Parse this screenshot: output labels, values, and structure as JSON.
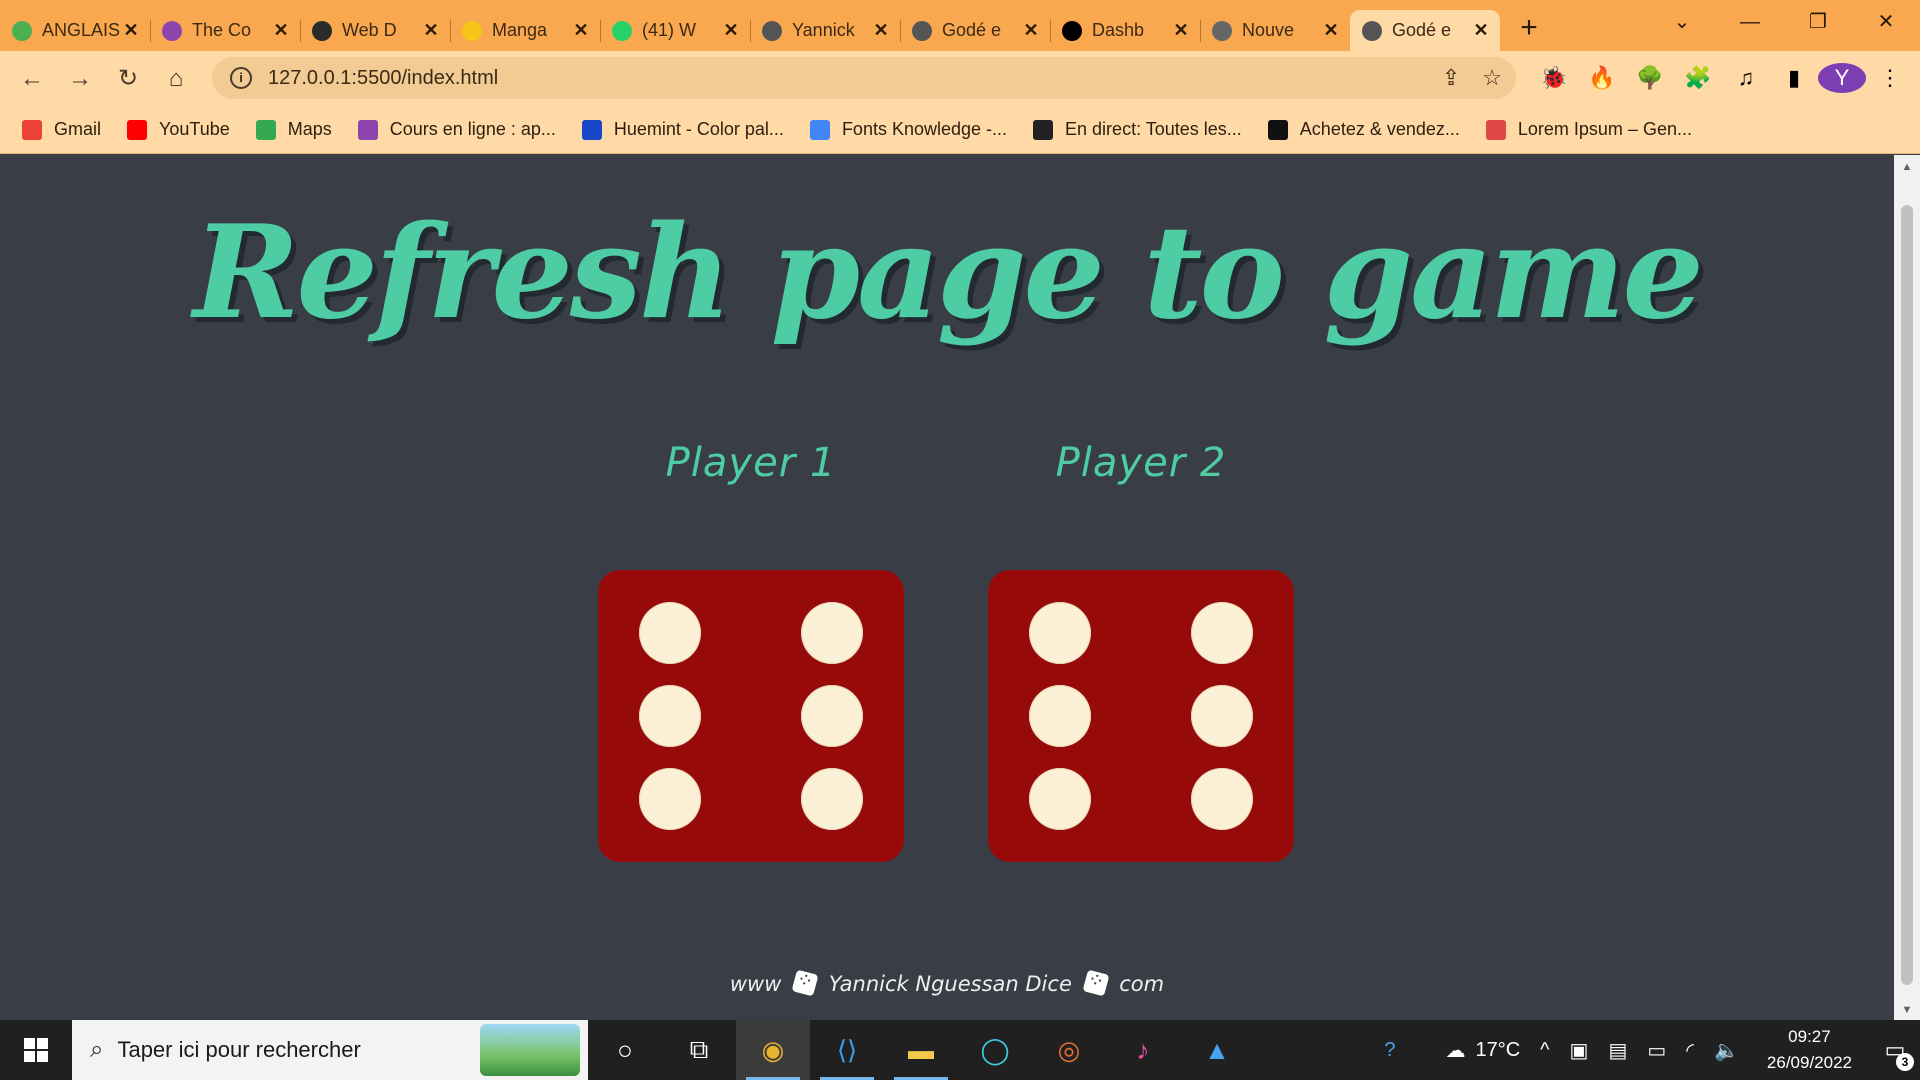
{
  "browser": {
    "tabs": [
      {
        "title": "ANGLAIS",
        "icon": "leaf-icon",
        "color": "#4caf50",
        "active": false
      },
      {
        "title": "The Co",
        "icon": "udemy-icon",
        "color": "#8e44ad",
        "active": false
      },
      {
        "title": "Web D",
        "icon": "hand-icon",
        "color": "#2b2b2b",
        "active": false
      },
      {
        "title": "Manga",
        "icon": "m-logo-icon",
        "color": "#f5c518",
        "active": false
      },
      {
        "title": "(41) W",
        "icon": "whatsapp-icon",
        "color": "#25d366",
        "active": false
      },
      {
        "title": "Yannick",
        "icon": "globe-icon",
        "color": "#555555",
        "active": false
      },
      {
        "title": "Godé e",
        "icon": "globe-icon",
        "color": "#555555",
        "active": false
      },
      {
        "title": "Dashb",
        "icon": "triangle-icon",
        "color": "#000000",
        "active": false
      },
      {
        "title": "Nouve",
        "icon": "chrome-icon",
        "color": "#666666",
        "active": false
      },
      {
        "title": "Godé e",
        "icon": "globe-icon",
        "color": "#555555",
        "active": true
      }
    ],
    "url": "127.0.0.1:5500/index.html",
    "profile_initial": "Y",
    "bookmarks": [
      {
        "label": "Gmail",
        "icon": "gmail-icon",
        "color": "#ea4335"
      },
      {
        "label": "YouTube",
        "icon": "youtube-icon",
        "color": "#ff0000"
      },
      {
        "label": "Maps",
        "icon": "maps-icon",
        "color": "#34a853"
      },
      {
        "label": "Cours en ligne  : ap...",
        "icon": "udemy-icon",
        "color": "#8e44ad"
      },
      {
        "label": "Huemint - Color pal...",
        "icon": "huemint-icon",
        "color": "#1a47c8"
      },
      {
        "label": "Fonts Knowledge -...",
        "icon": "fonts-icon",
        "color": "#4285f4"
      },
      {
        "label": "En direct: Toutes les...",
        "icon": "plus-icon",
        "color": "#222222"
      },
      {
        "label": "Achetez & vendez...",
        "icon": "bybit-icon",
        "color": "#111111"
      },
      {
        "label": "Lorem Ipsum – Gen...",
        "icon": "lorem-icon",
        "color": "#e04848"
      }
    ]
  },
  "page": {
    "title": "Refresh page to game",
    "player1_label": "Player 1",
    "player2_label": "Player 2",
    "player1_roll": 6,
    "player2_roll": 6,
    "footer_prefix": "www",
    "footer_name": "Yannick Nguessan Dice",
    "footer_suffix": "com",
    "colors": {
      "accent": "#4ecca3",
      "background": "#393e46",
      "die": "#970a0a",
      "pip": "#fbefd5"
    }
  },
  "taskbar": {
    "search_placeholder": "Taper ici pour rechercher",
    "temperature": "17°C",
    "time": "09:27",
    "date": "26/09/2022",
    "notification_count": "3"
  }
}
